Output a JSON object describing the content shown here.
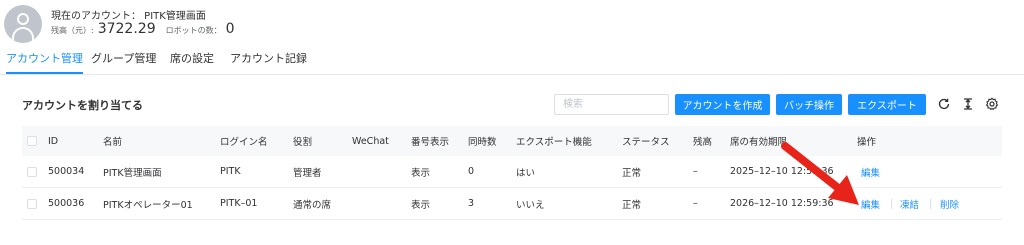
{
  "header": {
    "account_line": "現在のアカウント：  PITK管理画面",
    "balance_label": "残高（元）:",
    "balance_value": "3722.29",
    "robot_label": "ロボットの数：",
    "robot_value": "0"
  },
  "tabs": [
    {
      "label": "アカウント管理",
      "active": true
    },
    {
      "label": "グループ管理",
      "active": false
    },
    {
      "label": "席の設定",
      "active": false
    },
    {
      "label": "アカウント記録",
      "active": false
    }
  ],
  "section": {
    "title": "アカウントを割り当てる",
    "search_placeholder": "検索"
  },
  "toolbar": {
    "create_label": "アカウントを作成",
    "batch_label": "バッチ操作",
    "export_label": "エクスポート",
    "icons": [
      "refresh-icon",
      "column-height-icon",
      "settings-icon"
    ]
  },
  "table": {
    "columns": [
      "ID",
      "名前",
      "ログイン名",
      "役割",
      "WeChat",
      "番号表示",
      "同時数",
      "エクスポート機能",
      "ステータス",
      "残高",
      "席の有効期限",
      "操作"
    ],
    "rows": [
      {
        "id": "500034",
        "name": "PITK管理画面",
        "login": "PITK",
        "role": "管理者",
        "wechat": "",
        "display": "表示",
        "concurrent": "0",
        "export": "はい",
        "status": "正常",
        "balance": "–",
        "expiry": "2025–12–10 12:59:36",
        "actions": [
          "編集"
        ]
      },
      {
        "id": "500036",
        "name": "PITKオペレーター01",
        "login": "PITK–01",
        "role": "通常の席",
        "wechat": "",
        "display": "表示",
        "concurrent": "3",
        "export": "いいえ",
        "status": "正常",
        "balance": "–",
        "expiry": "2026–12–10 12:59:36",
        "actions": [
          "編集",
          "凍結",
          "削除"
        ]
      }
    ]
  },
  "annotation": {
    "arrow_color": "#e8231a"
  },
  "colors": {
    "accent": "#1890ff",
    "header_bg": "#f7f8fa",
    "border": "#ebeef5"
  }
}
